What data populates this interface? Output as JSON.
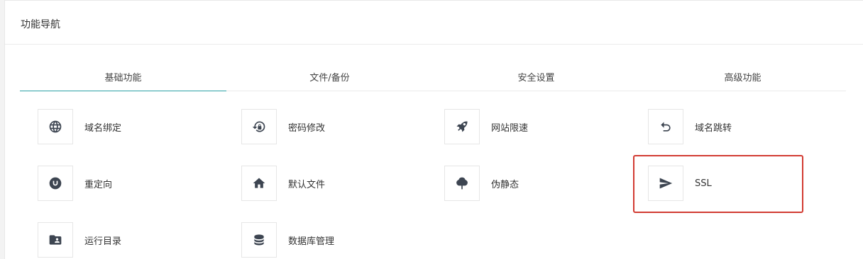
{
  "panel": {
    "title": "功能导航"
  },
  "tabs": [
    {
      "label": "基础功能",
      "active": true
    },
    {
      "label": "文件/备份",
      "active": false
    },
    {
      "label": "安全设置",
      "active": false
    },
    {
      "label": "高级功能",
      "active": false
    }
  ],
  "items": [
    {
      "label": "域名绑定",
      "icon": "globe-icon"
    },
    {
      "label": "密码修改",
      "icon": "lock-reset-icon"
    },
    {
      "label": "网站限速",
      "icon": "rocket-icon"
    },
    {
      "label": "域名跳转",
      "icon": "undo-arrow-icon"
    },
    {
      "label": "重定向",
      "icon": "redirect-u-icon"
    },
    {
      "label": "默认文件",
      "icon": "home-icon"
    },
    {
      "label": "伪静态",
      "icon": "tree-icon"
    },
    {
      "label": "SSL",
      "icon": "send-icon"
    },
    {
      "label": "运行目录",
      "icon": "folder-user-icon"
    },
    {
      "label": "数据库管理",
      "icon": "database-icon"
    }
  ],
  "colors": {
    "accent": "#2aa0a6",
    "icon": "#3d4551",
    "highlight": "#d23b32"
  }
}
